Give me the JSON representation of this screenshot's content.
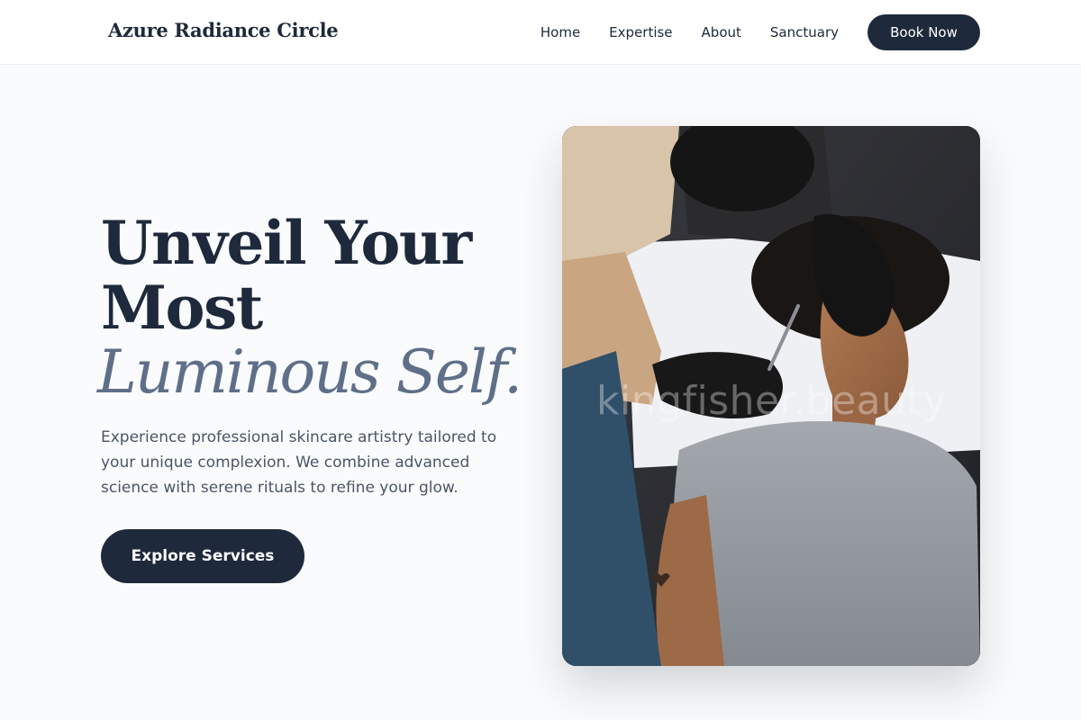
{
  "brand": {
    "name": "Azure Radiance Circle"
  },
  "nav": {
    "items": [
      "Home",
      "Expertise",
      "About",
      "Sanctuary"
    ],
    "cta_label": "Book Now"
  },
  "hero": {
    "heading_line1": "Unveil Your",
    "heading_line2": "Most",
    "heading_line3": "Luminous Self.",
    "description": "Experience professional skincare artistry tailored to your unique complexion. We combine advanced science with serene rituals to refine your glow.",
    "button_label": "Explore Services",
    "image_watermark": "kingfisher.beauty"
  },
  "colors": {
    "primary": "#1e293b",
    "accent_text": "#5f6f89",
    "body_text": "#4a5568",
    "background": "#fafbfc"
  }
}
